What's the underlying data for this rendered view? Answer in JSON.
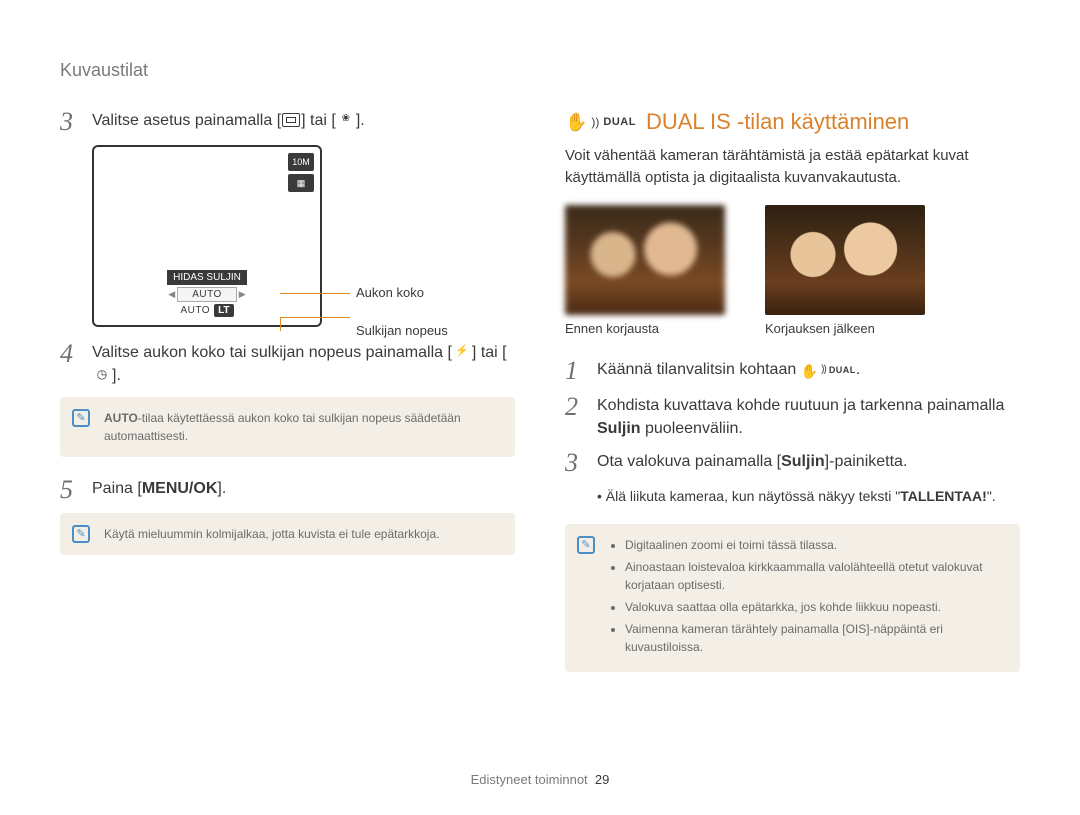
{
  "breadcrumb": "Kuvaustilat",
  "left": {
    "step3": {
      "num": "3",
      "text_a": "Valitse asetus painamalla [",
      "text_b": "] tai [",
      "text_c": "]."
    },
    "screen": {
      "icon_10m": "10M",
      "hidas": "HIDAS SULJIN",
      "auto1": "AUTO",
      "auto2": "AUTO",
      "lt": "LT",
      "label_aperture": "Aukon koko",
      "label_shutter": "Sulkijan nopeus"
    },
    "step4": {
      "num": "4",
      "text_a": "Valitse aukon koko tai sulkijan nopeus painamalla [",
      "text_b": "] tai [",
      "text_c": "]."
    },
    "note4_a": "AUTO",
    "note4_b": "-tilaa käytettäessä aukon koko tai sulkijan nopeus säädetään automaattisesti.",
    "step5": {
      "num": "5",
      "text_a": "Paina [",
      "menu": "MENU/OK",
      "text_b": "]."
    },
    "note5": "Käytä mieluummin kolmijalkaa, jotta kuvista ei tule epätarkkoja."
  },
  "right": {
    "title_dual": "DUAL",
    "title_text": "DUAL IS -tilan käyttäminen",
    "intro": "Voit vähentää kameran tärähtämistä ja estää epätarkat kuvat käyttämällä optista ja digitaalista kuvanvakautusta.",
    "caption_before": "Ennen korjausta",
    "caption_after": "Korjauksen jälkeen",
    "step1": {
      "num": "1",
      "text_a": "Käännä tilanvalitsin kohtaan ",
      "dual": "DUAL",
      "text_b": "."
    },
    "step2": {
      "num": "2",
      "text_a": "Kohdista kuvattava kohde ruutuun ja tarkenna painamalla ",
      "bold": "Suljin",
      "text_b": " puoleenväliin."
    },
    "step3": {
      "num": "3",
      "text_a": "Ota valokuva painamalla [",
      "bold": "Suljin",
      "text_b": "]-painiketta."
    },
    "bullet": {
      "a": "Älä liikuta kameraa, kun näytössä näkyy teksti \"",
      "bold": "TALLENTAA!",
      "b": "\"."
    },
    "notes": [
      "Digitaalinen zoomi ei toimi tässä tilassa.",
      "Ainoastaan loistevaloa kirkkaammalla valolähteellä otetut valokuvat korjataan optisesti.",
      "Valokuva saattaa olla epätarkka, jos kohde liikkuu nopeasti.",
      "Vaimenna kameran tärähtely painamalla [OIS]-näppäintä eri kuvaustiloissa."
    ]
  },
  "footer": {
    "section": "Edistyneet toiminnot",
    "page": "29"
  }
}
